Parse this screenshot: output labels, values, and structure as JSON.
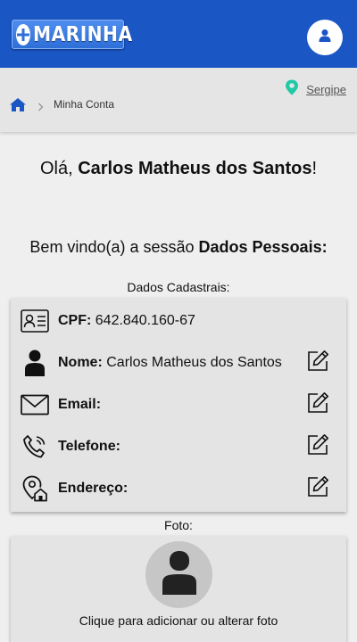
{
  "header": {
    "logo_text": "MARINHA",
    "user_icon": "user-avatar-icon",
    "brand_color": "#1a56c4"
  },
  "location": {
    "state": "Sergipe",
    "icon": "map-pin-icon",
    "icon_color": "#1ec9a6"
  },
  "breadcrumb": {
    "home_icon": "home-icon",
    "current": "Minha Conta"
  },
  "greeting": {
    "prefix": "Olá, ",
    "name": "Carlos Matheus dos Santos",
    "suffix": "!"
  },
  "welcome": {
    "prefix": "Bem vindo(a) a sessão ",
    "section": "Dados Pessoais:"
  },
  "dados": {
    "title": "Dados Cadastrais:",
    "rows": [
      {
        "key": "cpf",
        "label": "CPF:",
        "value": "642.840.160-67",
        "icon": "id-card-icon",
        "editable": false
      },
      {
        "key": "nome",
        "label": "Nome:",
        "value": "Carlos Matheus dos Santos",
        "icon": "user-icon",
        "editable": true
      },
      {
        "key": "email",
        "label": "Email:",
        "value": "",
        "icon": "envelope-icon",
        "editable": true
      },
      {
        "key": "telefone",
        "label": "Telefone:",
        "value": "",
        "icon": "phone-icon",
        "editable": true
      },
      {
        "key": "endereco",
        "label": "Endereço:",
        "value": "",
        "icon": "home-location-icon",
        "editable": true
      }
    ]
  },
  "foto": {
    "label": "Foto:",
    "caption": "Clique para adicionar ou alterar foto",
    "icon": "user-placeholder-icon"
  }
}
